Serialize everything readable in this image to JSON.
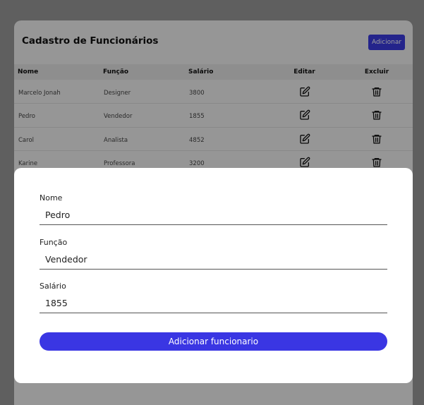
{
  "page": {
    "title": "Cadastro de Funcionários",
    "add_button": "Adicionar"
  },
  "table": {
    "headers": {
      "nome": "Nome",
      "funcao": "Função",
      "salario": "Salário",
      "editar": "Editar",
      "excluir": "Excluir"
    },
    "rows": [
      {
        "nome": "Marcelo Jonah",
        "funcao": "Designer",
        "salario": "3800"
      },
      {
        "nome": "Pedro",
        "funcao": "Vendedor",
        "salario": "1855"
      },
      {
        "nome": "Carol",
        "funcao": "Analista",
        "salario": "4852"
      },
      {
        "nome": "Karine",
        "funcao": "Professora",
        "salario": "3200"
      }
    ],
    "edit_icon": "edit-icon",
    "delete_icon": "trash-icon"
  },
  "modal": {
    "fields": {
      "nome": {
        "label": "Nome",
        "value": "Pedro"
      },
      "funcao": {
        "label": "Função",
        "value": "Vendedor"
      },
      "salario": {
        "label": "Salário",
        "value": "1855"
      }
    },
    "submit_label": "Adicionar funcionario"
  },
  "colors": {
    "accent": "#3a36e3",
    "background": "#f2f2f2",
    "modal_bg": "#ffffff"
  }
}
